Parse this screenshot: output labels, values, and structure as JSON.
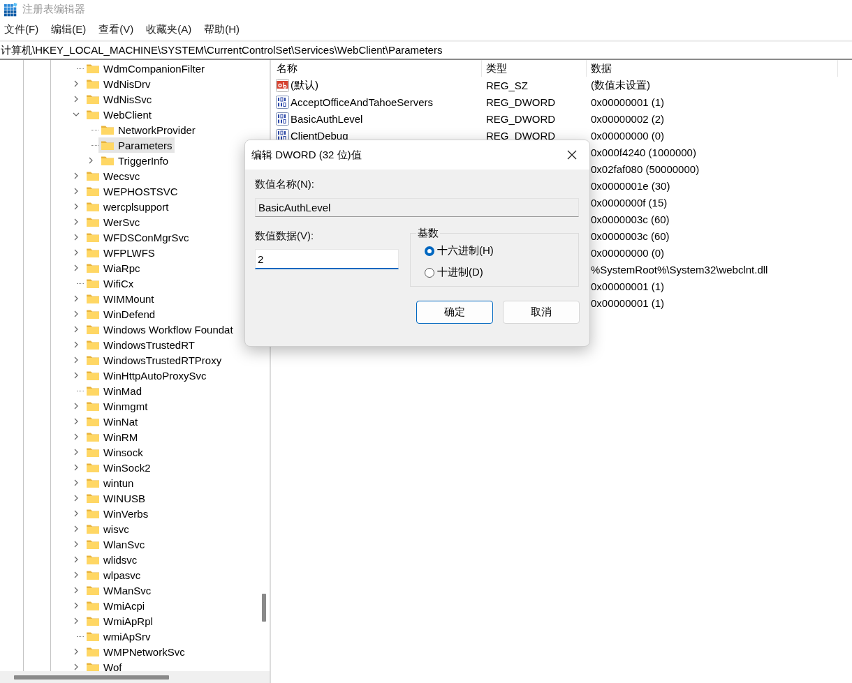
{
  "window": {
    "title": "注册表编辑器"
  },
  "menu": [
    "文件(F)",
    "编辑(E)",
    "查看(V)",
    "收藏夹(A)",
    "帮助(H)"
  ],
  "address": "计算机\\HKEY_LOCAL_MACHINE\\SYSTEM\\CurrentControlSet\\Services\\WebClient\\Parameters",
  "tree": {
    "items": [
      {
        "label": "WdmCompanionFilter",
        "kind": "leaf",
        "selected": false
      },
      {
        "label": "WdNisDrv",
        "kind": "branch",
        "expanded": false,
        "selected": false
      },
      {
        "label": "WdNisSvc",
        "kind": "branch",
        "expanded": false,
        "selected": false
      },
      {
        "label": "WebClient",
        "kind": "branch",
        "expanded": true,
        "selected": false,
        "children": [
          {
            "label": "NetworkProvider",
            "kind": "leaf",
            "selected": false
          },
          {
            "label": "Parameters",
            "kind": "leaf",
            "selected": true
          },
          {
            "label": "TriggerInfo",
            "kind": "branch",
            "expanded": false,
            "selected": false
          }
        ]
      },
      {
        "label": "Wecsvc",
        "kind": "branch",
        "expanded": false,
        "selected": false
      },
      {
        "label": "WEPHOSTSVC",
        "kind": "branch",
        "expanded": false,
        "selected": false
      },
      {
        "label": "wercplsupport",
        "kind": "branch",
        "expanded": false,
        "selected": false
      },
      {
        "label": "WerSvc",
        "kind": "branch",
        "expanded": false,
        "selected": false
      },
      {
        "label": "WFDSConMgrSvc",
        "kind": "branch",
        "expanded": false,
        "selected": false
      },
      {
        "label": "WFPLWFS",
        "kind": "branch",
        "expanded": false,
        "selected": false
      },
      {
        "label": "WiaRpc",
        "kind": "branch",
        "expanded": false,
        "selected": false
      },
      {
        "label": "WifiCx",
        "kind": "leaf",
        "selected": false
      },
      {
        "label": "WIMMount",
        "kind": "branch",
        "expanded": false,
        "selected": false
      },
      {
        "label": "WinDefend",
        "kind": "branch",
        "expanded": false,
        "selected": false
      },
      {
        "label": "Windows Workflow Foundat",
        "kind": "branch",
        "expanded": false,
        "selected": false
      },
      {
        "label": "WindowsTrustedRT",
        "kind": "branch",
        "expanded": false,
        "selected": false
      },
      {
        "label": "WindowsTrustedRTProxy",
        "kind": "branch",
        "expanded": false,
        "selected": false
      },
      {
        "label": "WinHttpAutoProxySvc",
        "kind": "branch",
        "expanded": false,
        "selected": false
      },
      {
        "label": "WinMad",
        "kind": "leaf",
        "selected": false
      },
      {
        "label": "Winmgmt",
        "kind": "branch",
        "expanded": false,
        "selected": false
      },
      {
        "label": "WinNat",
        "kind": "branch",
        "expanded": false,
        "selected": false
      },
      {
        "label": "WinRM",
        "kind": "branch",
        "expanded": false,
        "selected": false
      },
      {
        "label": "Winsock",
        "kind": "branch",
        "expanded": false,
        "selected": false
      },
      {
        "label": "WinSock2",
        "kind": "branch",
        "expanded": false,
        "selected": false
      },
      {
        "label": "wintun",
        "kind": "branch",
        "expanded": false,
        "selected": false
      },
      {
        "label": "WINUSB",
        "kind": "branch",
        "expanded": false,
        "selected": false
      },
      {
        "label": "WinVerbs",
        "kind": "branch",
        "expanded": false,
        "selected": false
      },
      {
        "label": "wisvc",
        "kind": "branch",
        "expanded": false,
        "selected": false
      },
      {
        "label": "WlanSvc",
        "kind": "branch",
        "expanded": false,
        "selected": false
      },
      {
        "label": "wlidsvc",
        "kind": "branch",
        "expanded": false,
        "selected": false
      },
      {
        "label": "wlpasvc",
        "kind": "branch",
        "expanded": false,
        "selected": false
      },
      {
        "label": "WManSvc",
        "kind": "branch",
        "expanded": false,
        "selected": false
      },
      {
        "label": "WmiAcpi",
        "kind": "branch",
        "expanded": false,
        "selected": false
      },
      {
        "label": "WmiApRpl",
        "kind": "branch",
        "expanded": false,
        "selected": false
      },
      {
        "label": "wmiApSrv",
        "kind": "leaf",
        "selected": false
      },
      {
        "label": "WMPNetworkSvc",
        "kind": "branch",
        "expanded": false,
        "selected": false
      },
      {
        "label": "Wof",
        "kind": "branch",
        "expanded": false,
        "selected": false
      }
    ]
  },
  "values": {
    "columns": [
      "名称",
      "类型",
      "数据"
    ],
    "rows": [
      {
        "kind": "string",
        "name": "(默认)",
        "type": "REG_SZ",
        "data": "(数值未设置)"
      },
      {
        "kind": "binary",
        "name": "AcceptOfficeAndTahoeServers",
        "type": "REG_DWORD",
        "data": "0x00000001 (1)"
      },
      {
        "kind": "binary",
        "name": "BasicAuthLevel",
        "type": "REG_DWORD",
        "data": "0x00000002 (2)"
      },
      {
        "kind": "binary",
        "name": "ClientDebug",
        "type": "REG_DWORD",
        "data": "0x00000000 (0)"
      },
      {
        "data": "0x000f4240 (1000000)"
      },
      {
        "data": "0x02faf080 (50000000)"
      },
      {
        "data": "0x0000001e (30)"
      },
      {
        "data": "0x0000000f (15)"
      },
      {
        "data": "0x0000003c (60)"
      },
      {
        "data": "0x0000003c (60)"
      },
      {
        "data": "0x00000000 (0)"
      },
      {
        "data": "%SystemRoot%\\System32\\webclnt.dll"
      },
      {
        "data": "0x00000001 (1)"
      },
      {
        "data": "0x00000001 (1)"
      }
    ]
  },
  "dialog": {
    "title": "编辑 DWORD (32 位)值",
    "name_label": "数值名称(N):",
    "name_value": "BasicAuthLevel",
    "data_label": "数值数据(V):",
    "data_value": "2",
    "base_label": "基数",
    "bases": [
      {
        "label": "十六进制(H)",
        "selected": true
      },
      {
        "label": "十进制(D)",
        "selected": false
      }
    ],
    "buttons": [
      {
        "label": "确定",
        "kind": "primary"
      },
      {
        "label": "取消",
        "kind": "secondary"
      }
    ]
  }
}
